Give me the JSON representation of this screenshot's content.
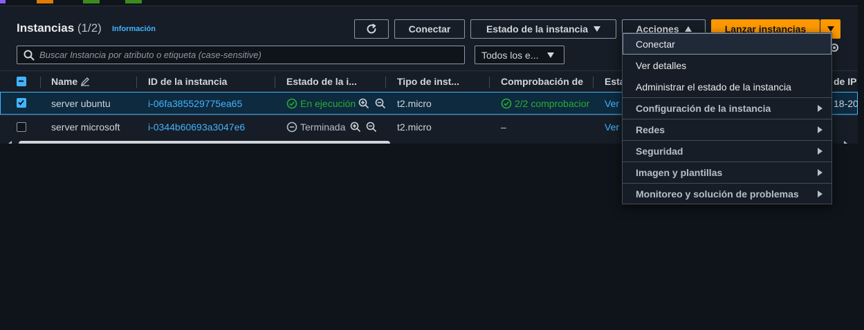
{
  "header": {
    "title": "Instancias",
    "count": "(1/2)",
    "info_link": "Información"
  },
  "toolbar": {
    "refresh_icon": "refresh-icon",
    "connect_label": "Conectar",
    "instance_state_label": "Estado de la instancia",
    "actions_label": "Acciones",
    "launch_label": "Lanzar instancias"
  },
  "search": {
    "placeholder": "Buscar Instancia por atributo o etiqueta (case-sensitive)",
    "value": ""
  },
  "filter": {
    "selected": "Todos los e..."
  },
  "table": {
    "columns": {
      "name": "Name",
      "instance_id": "ID de la instancia",
      "state": "Estado de la i...",
      "type": "Tipo de inst...",
      "check": "Comprobación de",
      "alarm": "Esta",
      "ip": "de IP"
    },
    "rows": [
      {
        "selected": true,
        "name": "server ubuntu",
        "instance_id": "i-06fa385529775ea65",
        "state": "En ejecución",
        "state_icon": "check-circle-icon",
        "type": "t2.micro",
        "check": "2/2 comprobacior",
        "alarm": "Ver",
        "ip": "18-20"
      },
      {
        "selected": false,
        "name": "server microsoft",
        "instance_id": "i-0344b60693a3047e6",
        "state": "Terminada",
        "state_icon": "minus-circle-icon",
        "type": "t2.micro",
        "check": "–",
        "alarm": "Ver",
        "ip": ""
      }
    ]
  },
  "actions_menu": {
    "items": [
      {
        "label": "Conectar"
      },
      {
        "label": "Ver detalles"
      },
      {
        "label": "Administrar el estado de la instancia"
      },
      {
        "label": "Configuración de la instancia"
      },
      {
        "label": "Redes"
      },
      {
        "label": "Seguridad"
      },
      {
        "label": "Imagen y plantillas"
      },
      {
        "label": "Monitoreo y solución de problemas"
      }
    ]
  },
  "colors": {
    "accent": "#ff9900",
    "link": "#42b4ff",
    "success": "#29ad32",
    "background": "#0f1b2a"
  }
}
